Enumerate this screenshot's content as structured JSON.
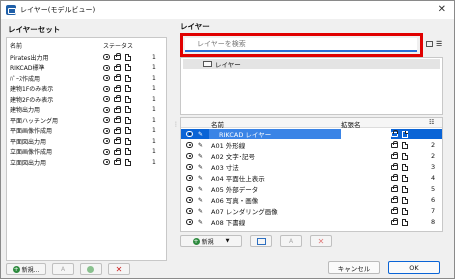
{
  "window": {
    "title": "レイヤー(モデルビュー)"
  },
  "left": {
    "title": "レイヤーセット",
    "headers": {
      "name": "名前",
      "status": "ステータス"
    },
    "rows": [
      {
        "name": "Pirates出力用",
        "num": "1"
      },
      {
        "name": "RIKCAD標準",
        "num": "1"
      },
      {
        "name": "ﾊﾟｰｽ作成用",
        "num": "1"
      },
      {
        "name": "建物1Fのみ表示",
        "num": "1"
      },
      {
        "name": "建物2Fのみ表示",
        "num": "1"
      },
      {
        "name": "建物出力用",
        "num": "1"
      },
      {
        "name": "平面ハッチング用",
        "num": "1"
      },
      {
        "name": "平面画像作成用",
        "num": "1"
      },
      {
        "name": "平面図出力用",
        "num": "1"
      },
      {
        "name": "立面画像作成用",
        "num": "1"
      },
      {
        "name": "立面図出力用",
        "num": "1"
      }
    ],
    "buttons": {
      "new": "新規...",
      "rename": "A",
      "duplicate": "",
      "delete": "✕"
    }
  },
  "right": {
    "title": "レイヤー",
    "search": {
      "placeholder": "レイヤーを検索"
    },
    "tree": {
      "item": "レイヤー"
    },
    "table": {
      "headers": {
        "name": "名前",
        "extension": "拡張名"
      },
      "rows": [
        {
          "name": "RIKCAD レイヤー",
          "num": "",
          "selected": true
        },
        {
          "name": "A01 外形線",
          "num": "2"
        },
        {
          "name": "A02 文字･記号",
          "num": "2"
        },
        {
          "name": "A03 寸法",
          "num": "3"
        },
        {
          "name": "A04 平面仕上表示",
          "num": "4"
        },
        {
          "name": "A05 外部データ",
          "num": "5"
        },
        {
          "name": "A06 写真・画像",
          "num": "6"
        },
        {
          "name": "A07 レンダリング画像",
          "num": "7"
        },
        {
          "name": "A08 下書線",
          "num": "8"
        }
      ]
    },
    "buttons": {
      "new": "新規"
    }
  },
  "footer": {
    "cancel": "キャンセル",
    "ok": "OK"
  },
  "colors": {
    "accent": "#0a64d6",
    "highlight": "#e00000"
  }
}
